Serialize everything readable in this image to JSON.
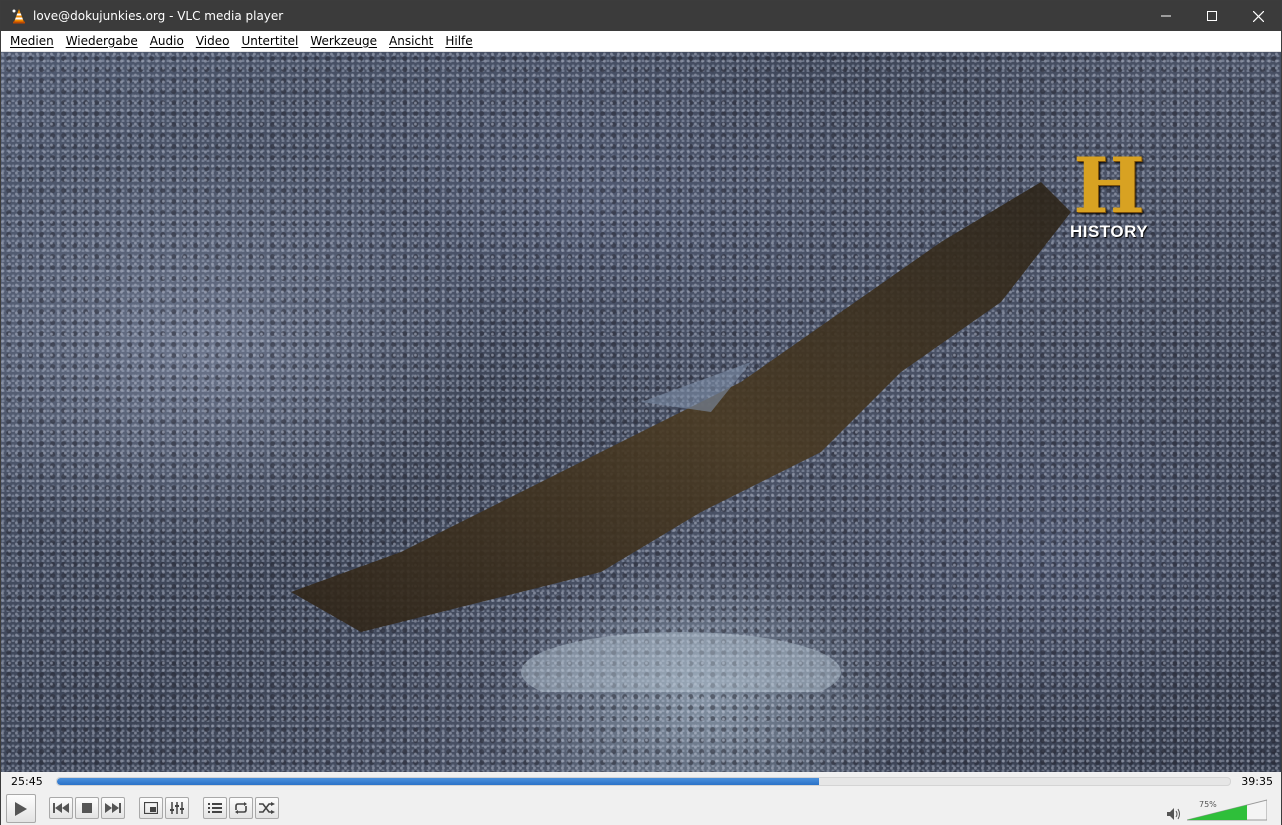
{
  "window": {
    "title": "love@dokujunkies.org - VLC media player",
    "controls": {
      "minimize": "—",
      "maximize": "☐",
      "close": "✕"
    }
  },
  "menu": [
    {
      "label": "Medien"
    },
    {
      "label": "Wiedergabe"
    },
    {
      "label": "Audio"
    },
    {
      "label": "Video"
    },
    {
      "label": "Untertitel"
    },
    {
      "label": "Werkzeuge"
    },
    {
      "label": "Ansicht"
    },
    {
      "label": "Hilfe"
    }
  ],
  "video": {
    "logo": {
      "mark": "H",
      "text": "HISTORY"
    }
  },
  "seek": {
    "elapsed": "25:45",
    "total": "39:35",
    "progress": 0.65
  },
  "volume": {
    "label": "75%",
    "level": 0.75
  },
  "colors": {
    "titlebar": "#3b3b3b",
    "seek_fill": "#2a72c8",
    "volume_fill": "#2fbf3a",
    "logo_gold": "#d8a222"
  },
  "icons": {
    "app": "vlc-cone-icon",
    "play": "play-icon",
    "prev": "previous-icon",
    "stop": "stop-icon",
    "next": "next-icon",
    "fullscreen": "fullscreen-icon",
    "extended": "extended-settings-icon",
    "playlist": "playlist-icon",
    "loop": "loop-icon",
    "shuffle": "shuffle-icon",
    "volume": "speaker-icon"
  }
}
